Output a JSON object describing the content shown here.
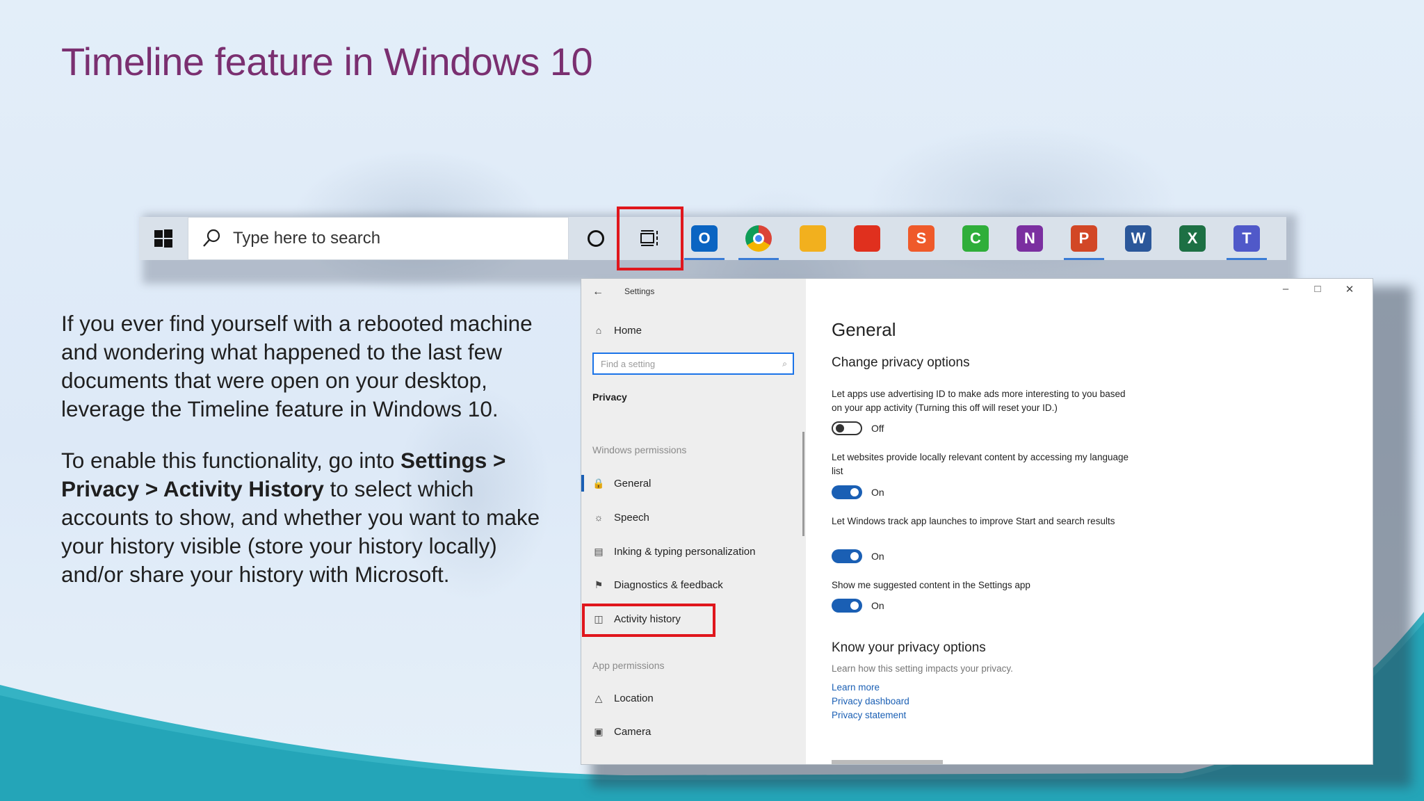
{
  "slide": {
    "title": "Timeline feature in Windows 10",
    "paragraph1": "If you ever find yourself with a rebooted machine and wondering what happened to the last few documents that were open on your desktop, leverage the Timeline feature in Windows 10.",
    "paragraph2_prefix": "To enable this functionality, go into ",
    "paragraph2_bold": "Settings > Privacy > Activity History",
    "paragraph2_suffix": " to select which accounts to show, and whether you want to make your history visible (store your history locally) and/or share your history with Microsoft."
  },
  "taskbar": {
    "search_placeholder": "Type here to search",
    "apps": [
      {
        "name": "outlook-icon",
        "letter": "O",
        "color": "#0a64c2"
      },
      {
        "name": "chrome-icon",
        "letter": "",
        "color": "#db4437"
      },
      {
        "name": "file-explorer-icon",
        "letter": "",
        "color": "#f2b01e"
      },
      {
        "name": "acrobat-icon",
        "letter": "",
        "color": "#e0301e"
      },
      {
        "name": "snagit-icon",
        "letter": "S",
        "color": "#ef5a2a"
      },
      {
        "name": "camtasia-icon",
        "letter": "C",
        "color": "#2fae3a"
      },
      {
        "name": "onenote-icon",
        "letter": "N",
        "color": "#7b2fa0"
      },
      {
        "name": "powerpoint-icon",
        "letter": "P",
        "color": "#d24726"
      },
      {
        "name": "word-icon",
        "letter": "W",
        "color": "#2b579a"
      },
      {
        "name": "excel-icon",
        "letter": "X",
        "color": "#1d7044"
      },
      {
        "name": "teams-icon",
        "letter": "T",
        "color": "#5059c9"
      }
    ]
  },
  "settings": {
    "window_title": "Settings",
    "home_label": "Home",
    "search_placeholder": "Find a setting",
    "section_privacy": "Privacy",
    "group_windows_permissions": "Windows permissions",
    "nav": {
      "general": "General",
      "speech": "Speech",
      "inking": "Inking & typing personalization",
      "diagnostics": "Diagnostics & feedback",
      "activity": "Activity history"
    },
    "group_app_permissions": "App permissions",
    "nav_app": {
      "location": "Location",
      "camera": "Camera"
    },
    "content": {
      "heading": "General",
      "subheading": "Change privacy options",
      "opt1_text": "Let apps use advertising ID to make ads more interesting to you based on your app activity (Turning this off will reset your ID.)",
      "opt1_state": "Off",
      "opt2_text": "Let websites provide locally relevant content by accessing my language list",
      "opt2_state": "On",
      "opt3_text": "Let Windows track app launches to improve Start and search results",
      "opt3_state": "On",
      "opt4_text": "Show me suggested content in the Settings app",
      "opt4_state": "On",
      "know_heading": "Know your privacy options",
      "know_text": "Learn how this setting impacts your privacy.",
      "link1": "Learn more",
      "link2": "Privacy dashboard",
      "link3": "Privacy statement"
    }
  }
}
